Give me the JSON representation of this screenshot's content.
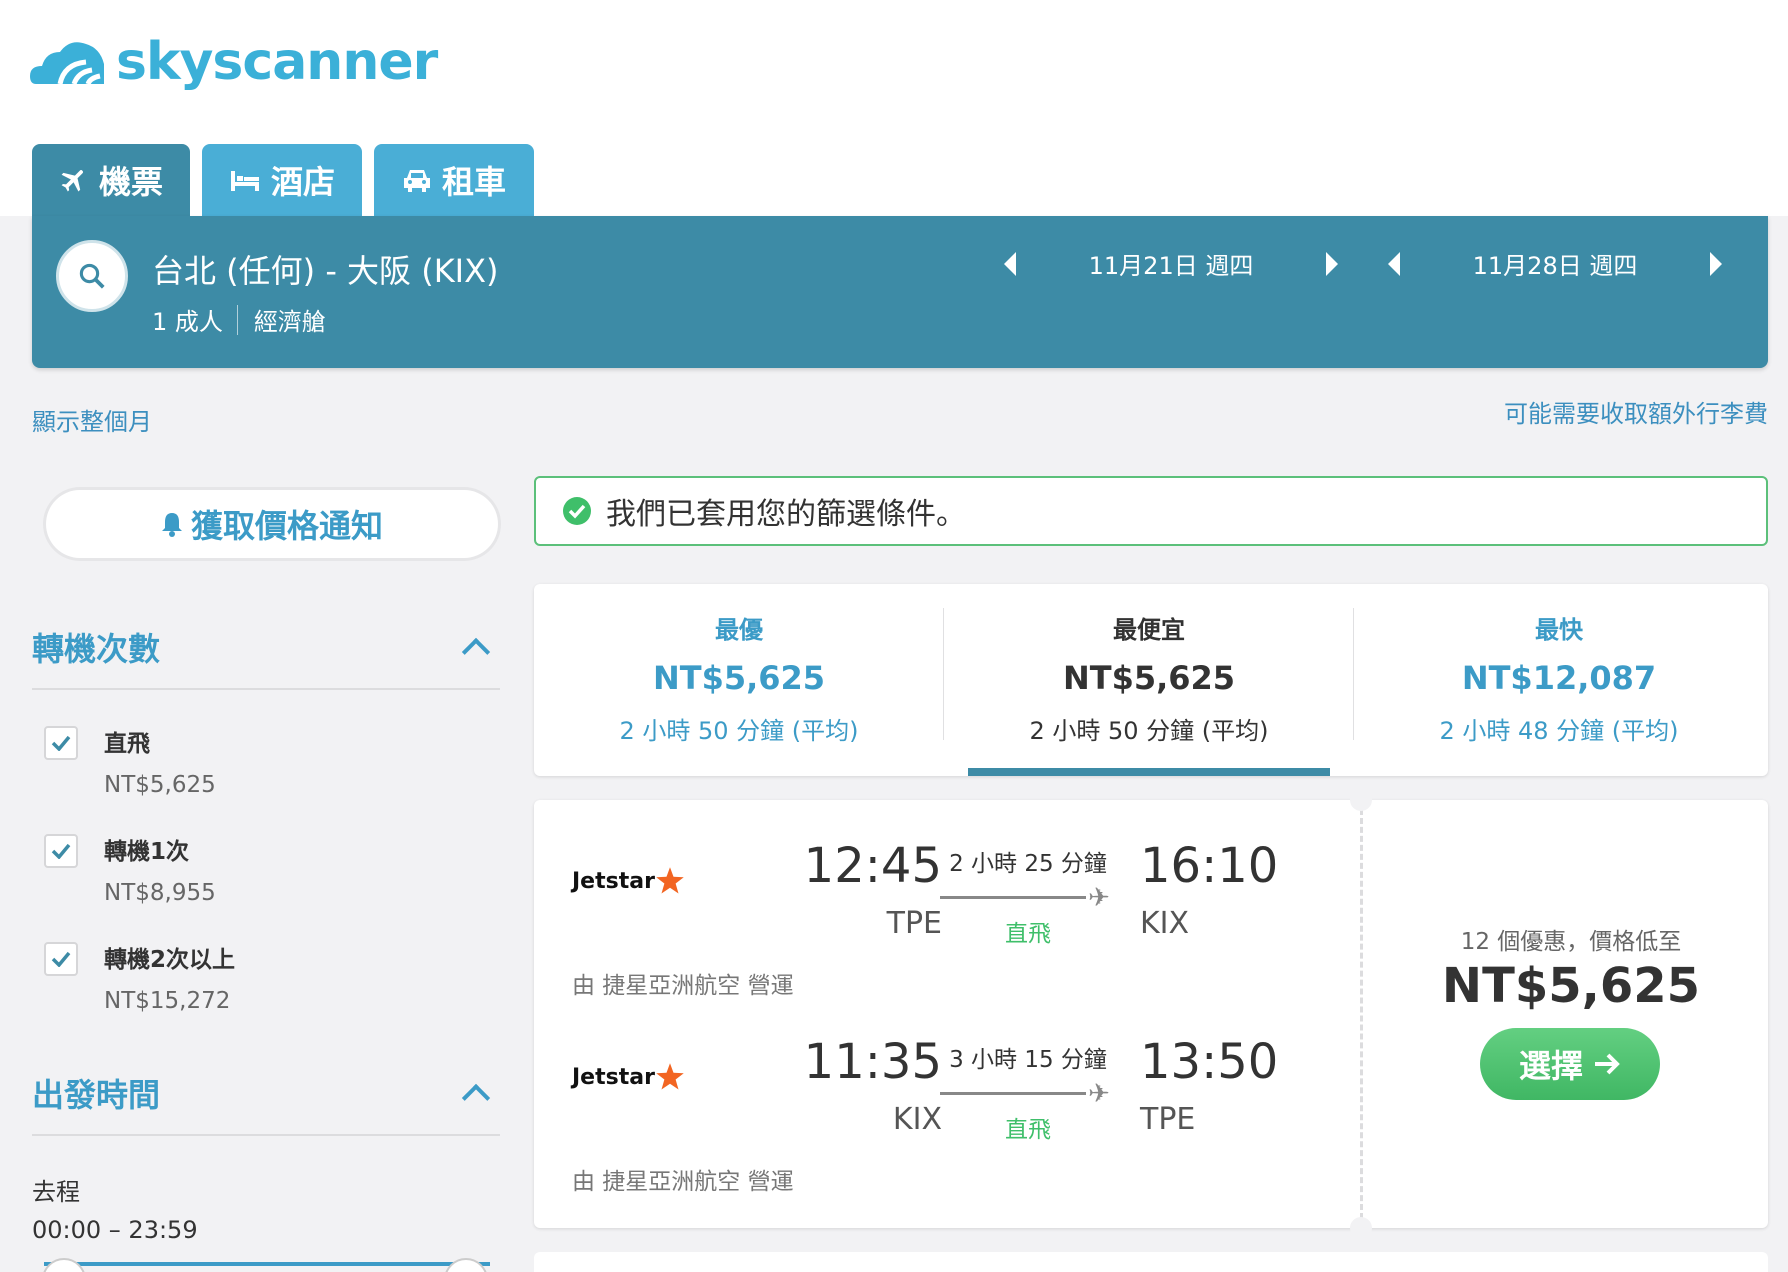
{
  "brand": {
    "name": "skyscanner",
    "color": "#3bb0d8"
  },
  "tabs": [
    {
      "label": "機票",
      "icon": "plane-icon",
      "active": true
    },
    {
      "label": "酒店",
      "icon": "bed-icon",
      "active": false
    },
    {
      "label": "租車",
      "icon": "car-icon",
      "active": false
    }
  ],
  "search": {
    "route": "台北 (任何) - 大阪 (KIX)",
    "passengers": "1 成人",
    "cabin": "經濟艙",
    "depart_date": "11月21日 週四",
    "return_date": "11月28日 週四"
  },
  "links": {
    "show_month": "顯示整個月",
    "baggage_fee": "可能需要收取額外行李費"
  },
  "price_alert": {
    "label": "獲取價格通知"
  },
  "filters": {
    "stops": {
      "title": "轉機次數",
      "options": [
        {
          "label": "直飛",
          "price": "NT$5,625",
          "checked": true
        },
        {
          "label": "轉機1次",
          "price": "NT$8,955",
          "checked": true
        },
        {
          "label": "轉機2次以上",
          "price": "NT$15,272",
          "checked": true
        }
      ]
    },
    "departure_time": {
      "title": "出發時間",
      "outbound_label": "去程",
      "outbound_range": "00:00 – 23:59"
    }
  },
  "applied_notice": "我們已套用您的篩選條件。",
  "sort": [
    {
      "label": "最優",
      "price": "NT$5,625",
      "duration": "2 小時 50 分鐘 (平均)",
      "selected": false
    },
    {
      "label": "最便宜",
      "price": "NT$5,625",
      "duration": "2 小時 50 分鐘 (平均)",
      "selected": true
    },
    {
      "label": "最快",
      "price": "NT$12,087",
      "duration": "2 小時 48 分鐘 (平均)",
      "selected": false
    }
  ],
  "result": {
    "legs": [
      {
        "airline": "Jetstar",
        "dep_time": "12:45",
        "dep_code": "TPE",
        "duration": "2 小時 25 分鐘",
        "stops": "直飛",
        "arr_time": "16:10",
        "arr_code": "KIX",
        "operated_by": "由 捷星亞洲航空 營運"
      },
      {
        "airline": "Jetstar",
        "dep_time": "11:35",
        "dep_code": "KIX",
        "duration": "3 小時 15 分鐘",
        "stops": "直飛",
        "arr_time": "13:50",
        "arr_code": "TPE",
        "operated_by": "由 捷星亞洲航空 營運"
      }
    ],
    "deals_text": "12 個優惠，價格低至",
    "price": "NT$5,625",
    "select_label": "選擇"
  },
  "colors": {
    "header": "#3d8ba6",
    "tab": "#4aaed6",
    "link": "#3c9bc7",
    "green": "#40b764",
    "jetstar_star": "#f26522"
  }
}
